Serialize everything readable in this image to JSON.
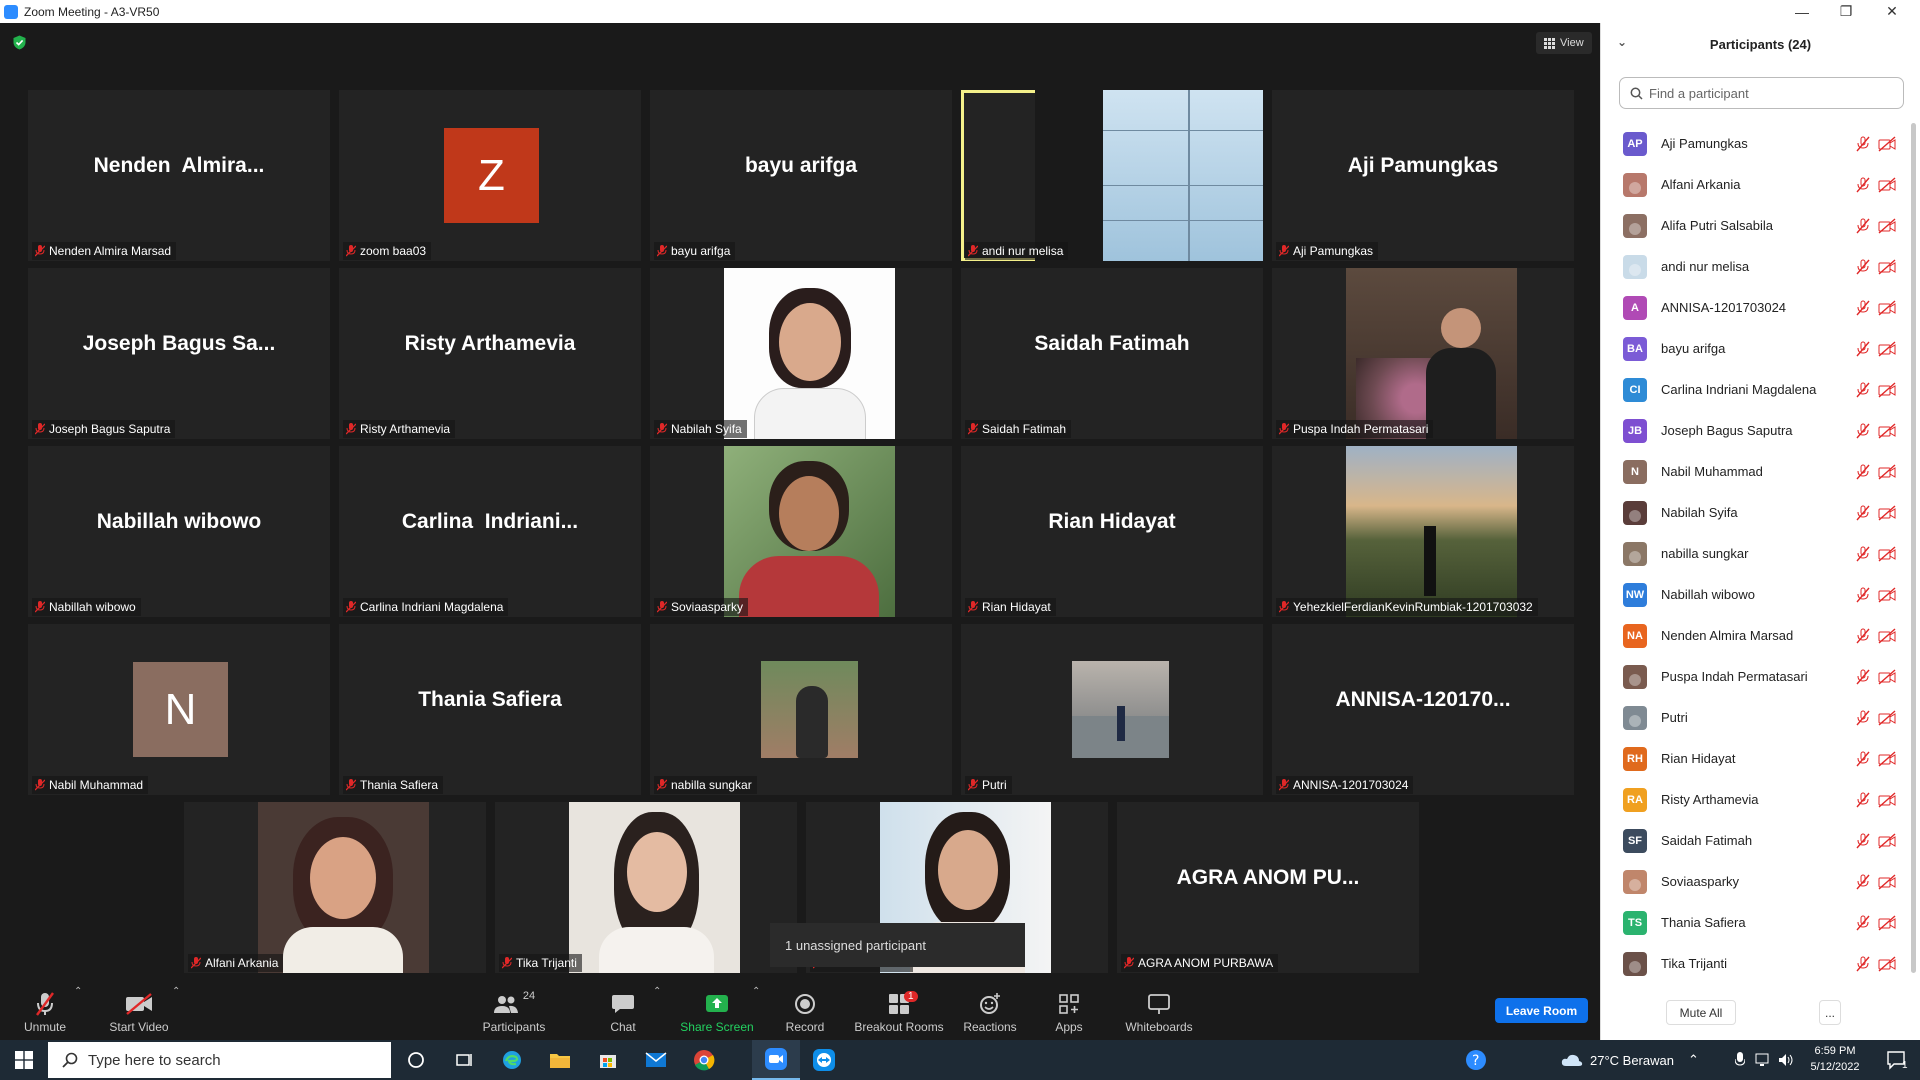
{
  "window": {
    "title": "Zoom Meeting - A3-VR50"
  },
  "view_label": "View",
  "tiles": [
    {
      "big": "Nenden  Almira...",
      "label": "Nenden Almira Marsad"
    },
    {
      "avatar": "Z",
      "avatar_color": "#c0381a",
      "label": "zoom baa03"
    },
    {
      "big": "bayu arifga",
      "label": "bayu arifga"
    },
    {
      "photo": "building",
      "label": "andi nur melisa",
      "active": true
    },
    {
      "big": "Aji Pamungkas",
      "label": "Aji Pamungkas"
    },
    {
      "big": "Joseph Bagus Sa...",
      "label": "Joseph Bagus Saputra"
    },
    {
      "big": "Risty Arthamevia",
      "label": "Risty Arthamevia"
    },
    {
      "photo": "portrait-white",
      "label": "Nabilah Syifa"
    },
    {
      "big": "Saidah Fatimah",
      "label": "Saidah Fatimah"
    },
    {
      "photo": "flowers",
      "label": "Puspa Indah Permatasari"
    },
    {
      "big": "Nabillah wibowo",
      "label": "Nabillah wibowo"
    },
    {
      "big": "Carlina  Indriani...",
      "label": "Carlina Indriani Magdalena"
    },
    {
      "photo": "portrait-red",
      "label": "Soviaasparky"
    },
    {
      "big": "Rian Hidayat",
      "label": "Rian Hidayat"
    },
    {
      "photo": "landscape",
      "label": "YehezkielFerdianKevinRumbiak-1201703032"
    },
    {
      "avatar": "N",
      "avatar_color": "#8a6d60",
      "label": "Nabil Muhammad"
    },
    {
      "big": "Thania Safiera",
      "label": "Thania Safiera"
    },
    {
      "small_photo": "hijab",
      "label": "nabilla sungkar"
    },
    {
      "small_photo": "rooftop",
      "label": "Putri"
    },
    {
      "big": "ANNISA-120170...",
      "label": "ANNISA-1201703024"
    },
    {
      "photo": "portrait-warm",
      "label": "Alfani Arkania"
    },
    {
      "photo": "portrait-light",
      "label": "Tika Trijanti"
    },
    {
      "photo": "portrait-window",
      "label": "andi nur melisa"
    },
    {
      "big": "AGRA ANOM PU...",
      "label": "AGRA ANOM PURBAWA"
    }
  ],
  "unassigned": "1 unassigned participant",
  "toolbar": {
    "unmute": "Unmute",
    "start_video": "Start Video",
    "participants": "Participants",
    "participants_count": "24",
    "chat": "Chat",
    "share_screen": "Share Screen",
    "record": "Record",
    "breakout_rooms": "Breakout Rooms",
    "breakout_badge": "1",
    "reactions": "Reactions",
    "apps": "Apps",
    "whiteboards": "Whiteboards",
    "leave_room": "Leave Room"
  },
  "panel": {
    "title": "Participants (24)",
    "search_placeholder": "Find a participant",
    "participants": [
      {
        "initials": "AP",
        "color": "#6a5acd",
        "name": "Aji Pamungkas"
      },
      {
        "photo": true,
        "color": "#b7786b",
        "name": "Alfani Arkania"
      },
      {
        "photo": true,
        "color": "#8c6f63",
        "name": "Alifa Putri Salsabila"
      },
      {
        "photo": true,
        "color": "#c9dbe8",
        "name": "andi nur melisa"
      },
      {
        "initials": "A",
        "color": "#b04ab5",
        "name": "ANNISA-1201703024"
      },
      {
        "initials": "BA",
        "color": "#7b5bd6",
        "name": "bayu arifga"
      },
      {
        "initials": "CI",
        "color": "#2e8bd6",
        "name": "Carlina Indriani Magdalena"
      },
      {
        "initials": "JB",
        "color": "#7e4fd1",
        "name": "Joseph Bagus Saputra"
      },
      {
        "initials": "N",
        "color": "#8a6d60",
        "name": "Nabil Muhammad"
      },
      {
        "photo": true,
        "color": "#5a3d3a",
        "name": "Nabilah Syifa"
      },
      {
        "photo": true,
        "color": "#8b7766",
        "name": "nabilla sungkar"
      },
      {
        "initials": "NW",
        "color": "#2e7ddb",
        "name": "Nabillah wibowo"
      },
      {
        "initials": "NA",
        "color": "#e8651f",
        "name": "Nenden Almira Marsad"
      },
      {
        "photo": true,
        "color": "#7a5b4f",
        "name": "Puspa Indah Permatasari"
      },
      {
        "photo": true,
        "color": "#7f8a93",
        "name": "Putri"
      },
      {
        "initials": "RH",
        "color": "#e06a1d",
        "name": "Rian Hidayat"
      },
      {
        "initials": "RA",
        "color": "#f0a020",
        "name": "Risty Arthamevia"
      },
      {
        "initials": "SF",
        "color": "#3c4b5e",
        "name": "Saidah Fatimah"
      },
      {
        "photo": true,
        "color": "#c0866b",
        "name": "Soviaasparky"
      },
      {
        "initials": "TS",
        "color": "#2bb36f",
        "name": "Thania Safiera"
      },
      {
        "photo": true,
        "color": "#6b5149",
        "name": "Tika Trijanti"
      }
    ],
    "mute_all": "Mute All",
    "more": "..."
  },
  "taskbar": {
    "search_placeholder": "Type here to search",
    "weather": "27°C  Berawan",
    "time": "6:59 PM",
    "date": "5/12/2022",
    "notifications": "1"
  }
}
